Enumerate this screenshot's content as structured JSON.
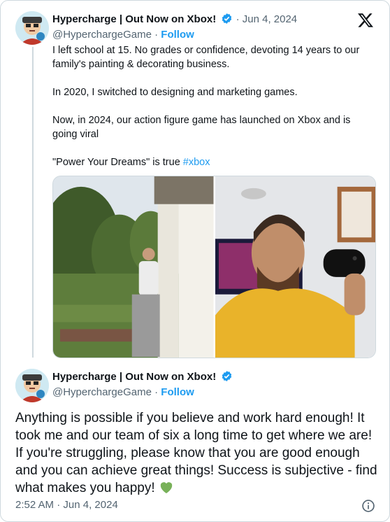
{
  "parent_tweet": {
    "display_name": "Hypercharge | Out Now on Xbox!",
    "separator": "·",
    "date": "Jun 4, 2024",
    "handle": "@HyperchargeGame",
    "follow_label": "Follow",
    "paragraphs": [
      "I left school at 15. No grades or confidence, devoting 14 years to our family's painting & decorating business.",
      "In 2020, I switched to designing and marketing games.",
      "Now, in 2024, our action figure game has launched on Xbox and is going viral"
    ],
    "last_line_prefix": "\"Power Your Dreams\" is true ",
    "hashtag": "#xbox",
    "images": [
      "man-painting-house-photo",
      "man-holding-xbox-controller-photo"
    ]
  },
  "reply_tweet": {
    "display_name": "Hypercharge | Out Now on Xbox!",
    "handle": "@HyperchargeGame",
    "separator": "·",
    "follow_label": "Follow",
    "text": "Anything is possible if you believe and work hard enough! It took me and our team of six a long time to get where we are! If you're struggling, please know that you are good enough and you can achieve great things! Success is subjective - find what makes you happy!",
    "emoji": "green-heart",
    "time": "2:52 AM",
    "date": "Jun 4, 2024"
  },
  "icons": {
    "verified_color": "#1d9bf0",
    "platform_logo": "x-logo-icon",
    "info": "info-icon"
  },
  "colors": {
    "link": "#1d9bf0",
    "muted": "#536471",
    "text": "#0f1419"
  }
}
